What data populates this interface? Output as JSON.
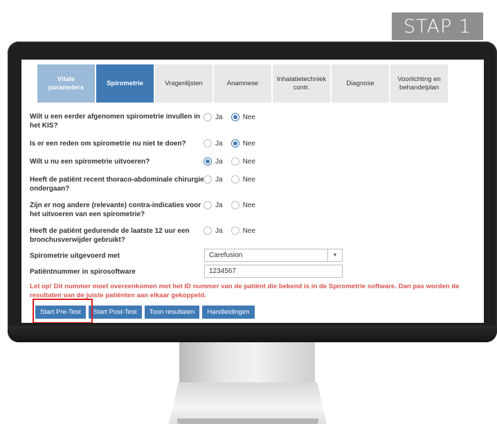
{
  "step_badge": "STAP 1",
  "tabs": [
    {
      "label": "Vitale parameters",
      "state": "done"
    },
    {
      "label": "Spirometrie",
      "state": "active"
    },
    {
      "label": "Vragenlijsten",
      "state": "inactive"
    },
    {
      "label": "Anamnese",
      "state": "inactive"
    },
    {
      "label": "Inhalatietechniek contr.",
      "state": "inactive"
    },
    {
      "label": "Diagnose",
      "state": "inactive"
    },
    {
      "label": "Voorlichting en behandelplan",
      "state": "inactive"
    }
  ],
  "questions": [
    {
      "text": "Wilt u een eerder afgenomen spirometrie invullen in het KIS?",
      "yes": "Ja",
      "no": "Nee",
      "selected": "Nee"
    },
    {
      "text": "Is er een reden om spirometrie nu niet te doen?",
      "yes": "Ja",
      "no": "Nee",
      "selected": "Nee"
    },
    {
      "text": "Wilt u nu een spirometrie uitvoeren?",
      "yes": "Ja",
      "no": "Nee",
      "selected": "Ja"
    },
    {
      "text": "Heeft de patiënt recent thoraco-abdominale chirurgie ondergaan?",
      "yes": "Ja",
      "no": "Nee",
      "selected": ""
    },
    {
      "text": "Zijn er nog andere (relevante) contra-indicaties voor het uitvoeren van een spirometrie?",
      "yes": "Ja",
      "no": "Nee",
      "selected": ""
    },
    {
      "text": "Heeft de patiënt gedurende de laatste 12 uur een bronchusverwijder gebruikt?",
      "yes": "Ja",
      "no": "Nee",
      "selected": ""
    }
  ],
  "spiro_device": {
    "label": "Spirometrie uitgevoerd met",
    "value": "Carefusion"
  },
  "patient_number": {
    "label": "Patiëntnummer in spirosoftware",
    "value": "1234567"
  },
  "warning": "Let op! Dit nummer moet overeenkomen met het ID nummer van de patiënt die bekend is in de Spirometrie software. Dan pas worden de resultaten van de juiste patiënten aan elkaar gekoppeld.",
  "buttons": {
    "start_pre": "Start Pre-Test",
    "start_post": "Start Post-Test",
    "results": "Toon resultaten",
    "manuals": "Handleidingen"
  },
  "colors": {
    "accent": "#3f7ab5",
    "warning": "#d9534f",
    "highlight": "#e0201f"
  }
}
